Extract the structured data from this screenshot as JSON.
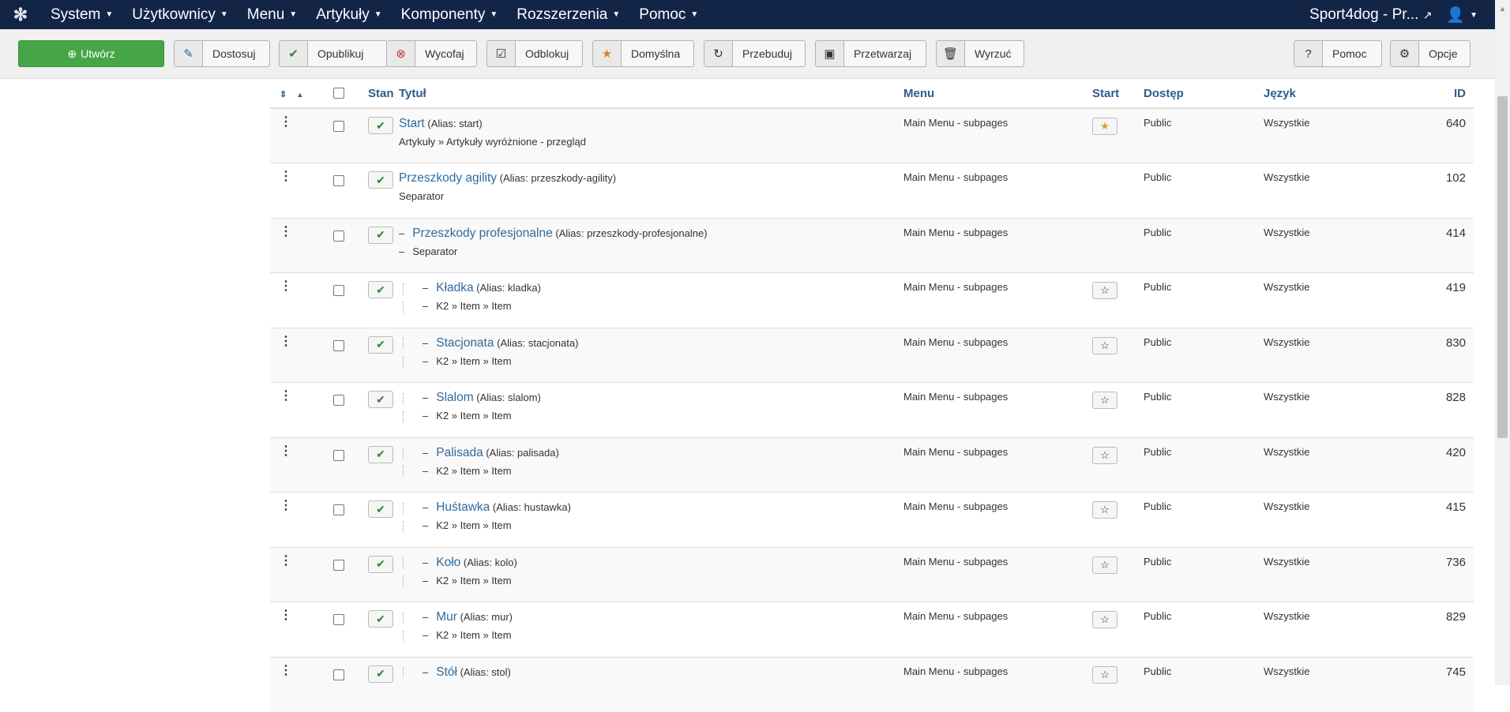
{
  "navbar": {
    "items": [
      "System",
      "Użytkownicy",
      "Menu",
      "Artykuły",
      "Komponenty",
      "Rozszerzenia",
      "Pomoc"
    ],
    "site_name": "Sport4dog - Pr..."
  },
  "toolbar": {
    "create": "Utwórz",
    "edit": "Dostosuj",
    "publish": "Opublikuj",
    "unpublish": "Wycofaj",
    "checkin": "Odblokuj",
    "default": "Domyślna",
    "rebuild": "Przebuduj",
    "batch": "Przetwarzaj",
    "trash": "Wyrzuć",
    "help": "Pomoc",
    "options": "Opcje"
  },
  "table": {
    "headers": {
      "state": "Stan",
      "title": "Tytuł",
      "menu": "Menu",
      "home": "Start",
      "access": "Dostęp",
      "language": "Język",
      "id": "ID"
    },
    "rows": [
      {
        "title": "Start",
        "alias": "(Alias: start)",
        "type": "Artykuły » Artykuły wyróżnione - przegląd",
        "level": 0,
        "menu": "Main Menu - subpages",
        "home": "featured",
        "access": "Public",
        "language": "Wszystkie",
        "id": "640"
      },
      {
        "title": "Przeszkody agility",
        "alias": "(Alias: przeszkody-agility)",
        "type": "Separator",
        "level": 0,
        "menu": "Main Menu - subpages",
        "home": "none",
        "access": "Public",
        "language": "Wszystkie",
        "id": "102"
      },
      {
        "title": "Przeszkody profesjonalne",
        "alias": "(Alias: przeszkody-profesjonalne)",
        "type": "Separator",
        "level": 1,
        "menu": "Main Menu - subpages",
        "home": "none",
        "access": "Public",
        "language": "Wszystkie",
        "id": "414"
      },
      {
        "title": "Kładka",
        "alias": "(Alias: kladka)",
        "type": "K2 » Item » Item",
        "level": 2,
        "menu": "Main Menu - subpages",
        "home": "unfeatured",
        "access": "Public",
        "language": "Wszystkie",
        "id": "419"
      },
      {
        "title": "Stacjonata",
        "alias": "(Alias: stacjonata)",
        "type": "K2 » Item » Item",
        "level": 2,
        "menu": "Main Menu - subpages",
        "home": "unfeatured",
        "access": "Public",
        "language": "Wszystkie",
        "id": "830"
      },
      {
        "title": "Slalom",
        "alias": "(Alias: slalom)",
        "type": "K2 » Item » Item",
        "level": 2,
        "menu": "Main Menu - subpages",
        "home": "unfeatured",
        "access": "Public",
        "language": "Wszystkie",
        "id": "828"
      },
      {
        "title": "Palisada",
        "alias": "(Alias: palisada)",
        "type": "K2 » Item » Item",
        "level": 2,
        "menu": "Main Menu - subpages",
        "home": "unfeatured",
        "access": "Public",
        "language": "Wszystkie",
        "id": "420"
      },
      {
        "title": "Huśtawka",
        "alias": "(Alias: hustawka)",
        "type": "K2 » Item » Item",
        "level": 2,
        "menu": "Main Menu - subpages",
        "home": "unfeatured",
        "access": "Public",
        "language": "Wszystkie",
        "id": "415"
      },
      {
        "title": "Koło",
        "alias": "(Alias: kolo)",
        "type": "K2 » Item » Item",
        "level": 2,
        "menu": "Main Menu - subpages",
        "home": "unfeatured",
        "access": "Public",
        "language": "Wszystkie",
        "id": "736"
      },
      {
        "title": "Mur",
        "alias": "(Alias: mur)",
        "type": "K2 » Item » Item",
        "level": 2,
        "menu": "Main Menu - subpages",
        "home": "unfeatured",
        "access": "Public",
        "language": "Wszystkie",
        "id": "829"
      },
      {
        "title": "Stół",
        "alias": "(Alias: stol)",
        "type": "",
        "level": 2,
        "menu": "Main Menu - subpages",
        "home": "unfeatured",
        "access": "Public",
        "language": "Wszystkie",
        "id": "745"
      }
    ]
  }
}
